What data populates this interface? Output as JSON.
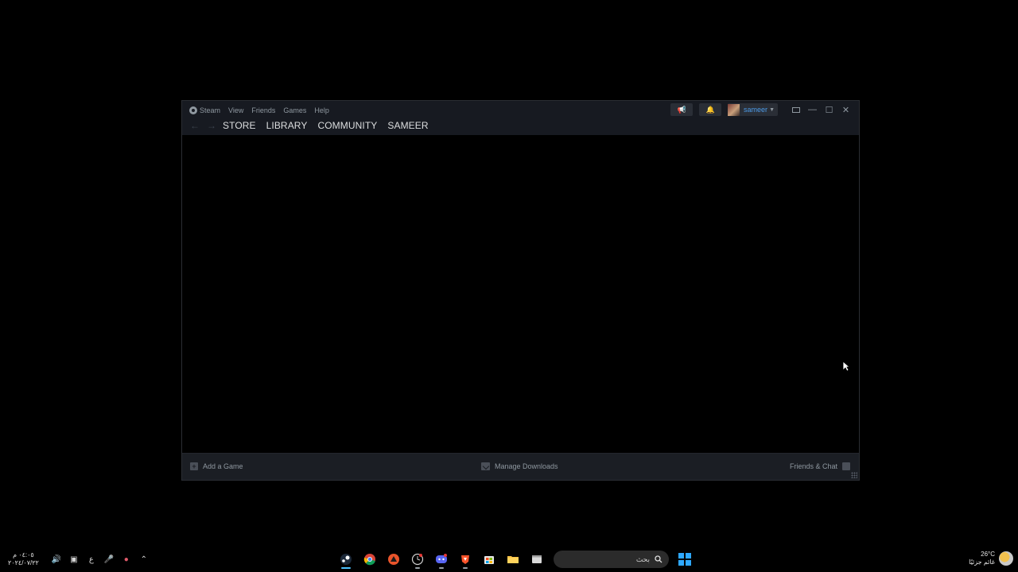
{
  "window": {
    "menu": [
      "Steam",
      "View",
      "Friends",
      "Games",
      "Help"
    ],
    "nav_tabs": [
      "STORE",
      "LIBRARY",
      "COMMUNITY",
      "SAMEER"
    ],
    "account_name": "sameer"
  },
  "footer": {
    "add_game": "Add a Game",
    "manage_downloads": "Manage Downloads",
    "friends_chat": "Friends & Chat"
  },
  "taskbar": {
    "clock_time": "٠٤:٠٥ م",
    "clock_date": "٢٠٢٤/٠٧/٢٢",
    "lang": "ع",
    "search_placeholder": "بحث",
    "weather_temp": "26°C",
    "weather_desc": "غائم جزئيًا",
    "apps": [
      "steam-icon",
      "chrome-icon",
      "game-launcher-icon",
      "clock-app-icon",
      "discord-icon",
      "brave-icon",
      "store-icon",
      "file-explorer-icon",
      "window-icon"
    ]
  },
  "colors": {
    "titlebar": "#171a21",
    "footer": "#1b1e24",
    "account": "#4c9be8",
    "windows_blue": "#2ea8ff"
  }
}
